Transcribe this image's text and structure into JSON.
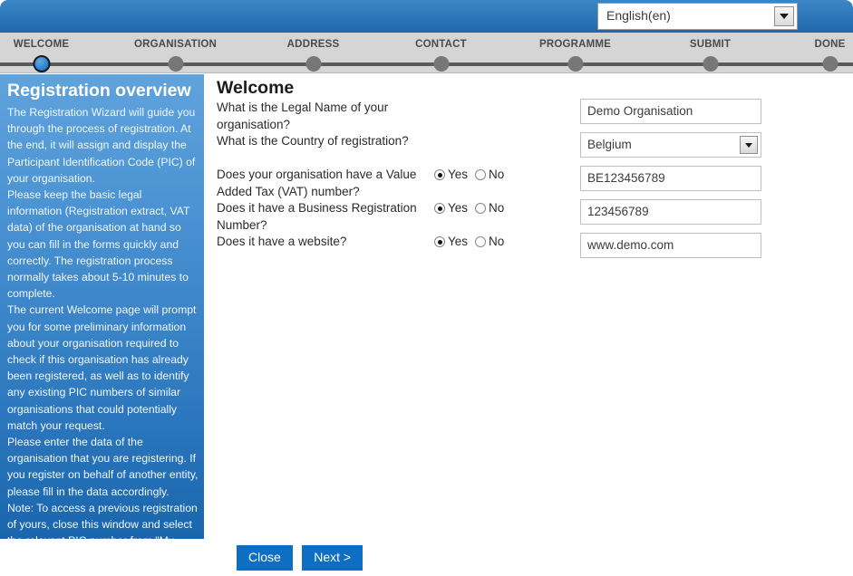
{
  "header": {
    "language_select": {
      "value": "English(en)",
      "arrow_icon": "chevron-down-icon"
    }
  },
  "steps": [
    {
      "label": "WELCOME",
      "active": true
    },
    {
      "label": "ORGANISATION",
      "active": false
    },
    {
      "label": "ADDRESS",
      "active": false
    },
    {
      "label": "CONTACT",
      "active": false
    },
    {
      "label": "PROGRAMME",
      "active": false
    },
    {
      "label": "SUBMIT",
      "active": false
    },
    {
      "label": "DONE",
      "active": false
    }
  ],
  "sidebar": {
    "title": "Registration overview",
    "paragraphs": [
      "The Registration Wizard will guide you through the process of registration. At the end, it will assign and display the Participant Identification Code (PIC) of your organisation.",
      "Please keep the basic legal information (Registration extract, VAT data) of the organisation at hand so you can fill in the forms quickly and correctly. The registration process normally takes about 5-10 minutes to complete.",
      "The current Welcome page will prompt you for some preliminary information about your organisation required to check if this organisation has already been registered, as well as to identify any existing PIC numbers of similar organisations that could potentially match your request.",
      "Please enter the data of the organisation that you are registering. If you register on behalf of another entity, please fill in the data accordingly.",
      "Note: To access a previous registration of yours, close this window and select the relevant PIC number from \"My Organisations\" > \"Organisation\" tab in the Participant Portal."
    ]
  },
  "main": {
    "title": "Welcome",
    "questions": {
      "legal_name": "What is the Legal Name of your organisation?",
      "country": "What is the Country of registration?",
      "vat": "Does your organisation have a Value Added Tax (VAT) number?",
      "business_registration": "Does it have a Business Registration Number?",
      "website": "Does it have a website?"
    },
    "radio_labels": {
      "yes": "Yes",
      "no": "No"
    },
    "radio_answers": {
      "vat": "Yes",
      "business_registration": "Yes",
      "website": "Yes"
    },
    "fields": {
      "legal_name": "Demo Organisation",
      "country": "Belgium",
      "vat_number": "BE123456789",
      "business_registration_number": "123456789",
      "website": "www.demo.com"
    }
  },
  "footer": {
    "close_label": "Close",
    "next_label": "Next >"
  },
  "colors": {
    "header_blue": "#2f79ba",
    "sidebar_blue": "#2e79bf",
    "button_blue": "#0d6fc4",
    "stepbar_gray": "#d5d5d5",
    "step_dot_gray": "#777777",
    "step_dot_active": "#2f86d4"
  }
}
